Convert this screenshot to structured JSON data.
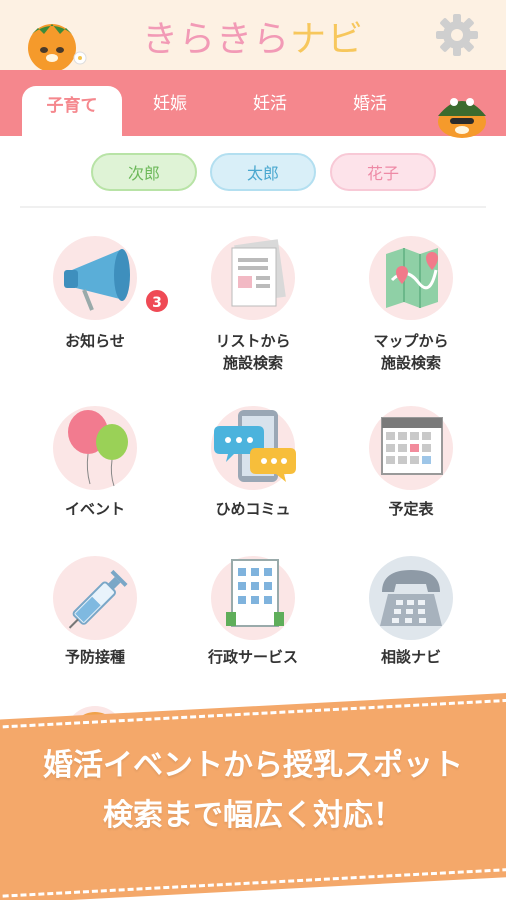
{
  "app": {
    "title_part1": "きらきら",
    "title_part2": "ナビ"
  },
  "tabs": [
    {
      "label": "子育て",
      "active": true
    },
    {
      "label": "妊娠",
      "active": false
    },
    {
      "label": "妊活",
      "active": false
    },
    {
      "label": "婚活",
      "active": false
    }
  ],
  "children": [
    {
      "label": "次郎",
      "bg": "#dff3d6",
      "border": "#b8e3a6",
      "fg": "#6cb85a"
    },
    {
      "label": "太郎",
      "bg": "#d9eff8",
      "border": "#b3dff0",
      "fg": "#4aa8cf"
    },
    {
      "label": "花子",
      "bg": "#fde3ea",
      "border": "#f8c9d6",
      "fg": "#ee8aa6"
    }
  ],
  "menu": [
    {
      "label": "お知らせ",
      "badge": "3"
    },
    {
      "label": "リストから",
      "label2": "施設検索"
    },
    {
      "label": "マップから",
      "label2": "施設検索"
    },
    {
      "label": "イベント"
    },
    {
      "label": "ひめコミュ"
    },
    {
      "label": "予定表"
    },
    {
      "label": "予防接種"
    },
    {
      "label": "行政サービス"
    },
    {
      "label": "相談ナビ"
    }
  ],
  "banner": {
    "line1": "婚活イベントから授乳スポット",
    "line2": "検索まで幅広く対応！"
  },
  "icons": {
    "settings": "gear-icon",
    "mascot": "mikan-mascot",
    "notice": "megaphone-icon",
    "list_search": "document-icon",
    "map_search": "map-pin-icon",
    "event": "balloon-icon",
    "community": "chat-bubble-icon",
    "calendar": "calendar-icon",
    "vaccine": "syringe-icon",
    "gov": "building-icon",
    "consult": "telephone-icon"
  },
  "colors": {
    "tab_bar": "#f5878d",
    "header_bg": "#fdf1e3",
    "banner": "#f4a86a",
    "badge": "#ef4a55"
  }
}
